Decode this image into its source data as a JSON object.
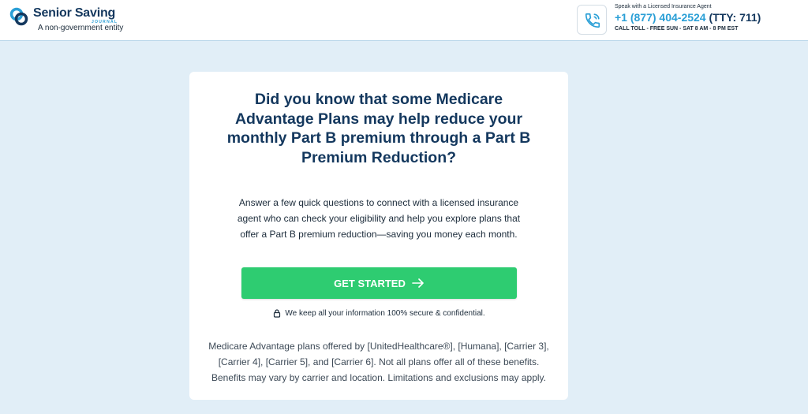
{
  "header": {
    "logo_name": "Senior Saving",
    "logo_sub": "JOURNAL",
    "tagline": "A non-government entity",
    "contact_label": "Speak with a Licensed Insurance Agent",
    "phone_number": "+1 (877) 404-2524",
    "tty": "(TTY: 711)",
    "hours": "CALL TOLL - FREE SUN - SAT 8 AM - 8 PM EST",
    "icons": {
      "logo": "logo-mark-icon",
      "phone": "phone-icon"
    }
  },
  "main": {
    "headline": "Did you know that some Medicare Advantage Plans may help reduce your monthly Part B premium through a Part B Premium Reduction?",
    "subtext": "Answer a few quick questions to connect with a licensed insurance agent who can check your eligibility and help you explore plans that offer a Part B premium reduction—saving you money each month.",
    "cta_label": "GET STARTED",
    "secure_text": "We keep all your information 100% secure & confidential.",
    "disclaimer": "Medicare Advantage plans offered by [UnitedHealthcare®], [Humana], [Carrier 3], [Carrier 4], [Carrier 5], and [Carrier 6]. Not all plans offer all of these benefits. Benefits may vary by carrier and location. Limitations and exclusions may apply.",
    "icons": {
      "cta": "arrow-right-icon",
      "secure": "lock-icon"
    }
  },
  "colors": {
    "page_background": "#e1eef7",
    "brand_navy": "#14385e",
    "brand_blue": "#2a9fd6",
    "cta_green": "#2ecc71",
    "card_background": "#ffffff"
  }
}
